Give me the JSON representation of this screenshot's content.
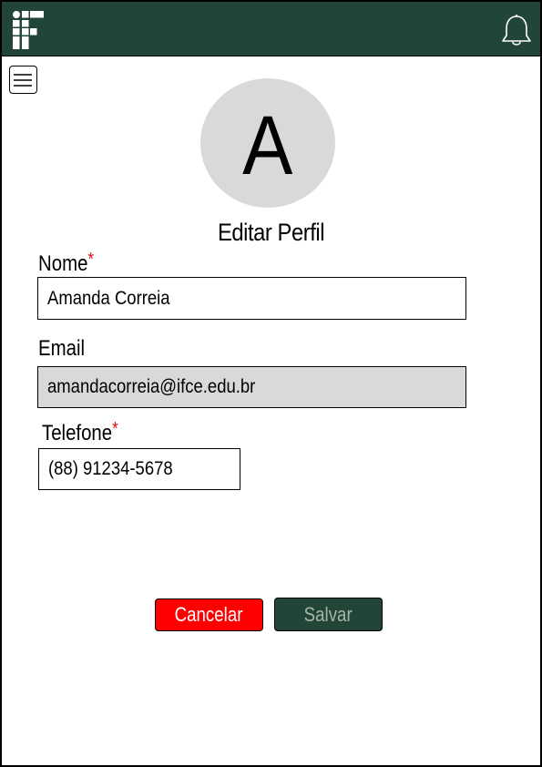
{
  "header": {
    "logo_icon": "ifce-logo-icon",
    "notification_icon": "bell-icon",
    "bar_color": "#214537"
  },
  "menu_icon": "hamburger-menu-icon",
  "avatar": {
    "initial": "A",
    "background": "#d9d9d9"
  },
  "form": {
    "title": "Editar Perfil",
    "fields": {
      "name": {
        "label": "Nome",
        "required_mark": "*",
        "value": "Amanda Correia"
      },
      "email": {
        "label": "Email",
        "value": "amandacorreia@ifce.edu.br",
        "disabled": true
      },
      "phone": {
        "label": "Telefone",
        "required_mark": "*",
        "value": "(88) 91234-5678"
      }
    },
    "actions": {
      "cancel_label": "Cancelar",
      "save_label": "Salvar",
      "cancel_color": "#ff0000",
      "save_color": "#214537"
    }
  }
}
